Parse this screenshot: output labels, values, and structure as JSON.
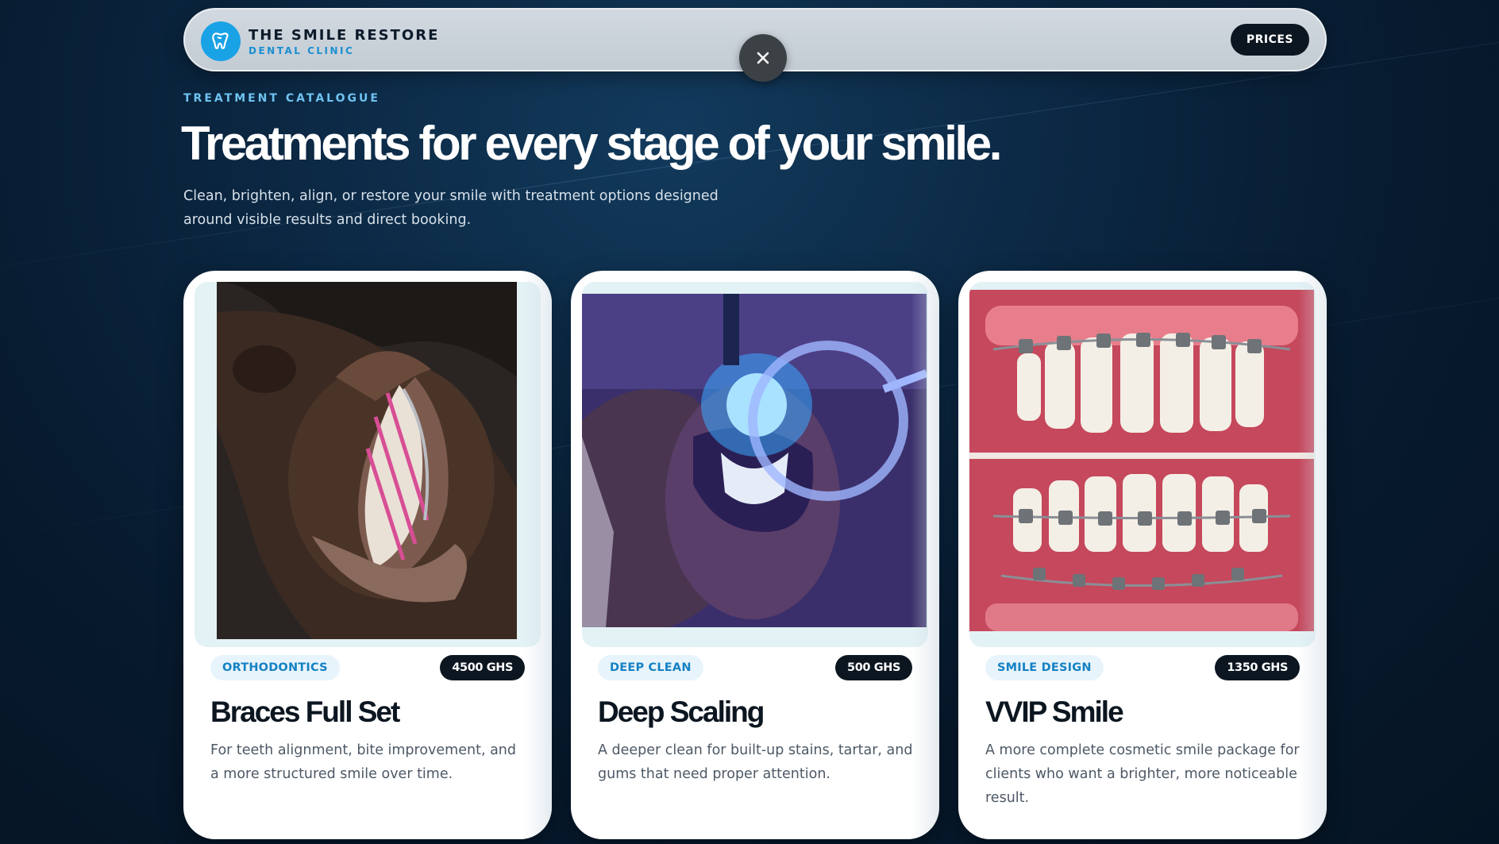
{
  "header": {
    "brand_name": "THE SMILE RESTORE",
    "brand_sub": "DENTAL CLINIC",
    "logo_icon": "tooth-icon",
    "prices_label": "PRICES",
    "close_icon": "close-icon"
  },
  "hero": {
    "eyebrow": "TREATMENT CATALOGUE",
    "title": "Treatments for every stage of your smile.",
    "subtitle": "Clean, brighten, align, or restore your smile with treatment options designed around visible results and direct booking."
  },
  "cards": [
    {
      "category": "ORTHODONTICS",
      "price": "4500 GHS",
      "title": "Braces Full Set",
      "description": "For teeth alignment, bite improvement, and a more structured smile over time."
    },
    {
      "category": "DEEP CLEAN",
      "price": "500 GHS",
      "title": "Deep Scaling",
      "description": "A deeper clean for built-up stains, tartar, and gums that need proper attention."
    },
    {
      "category": "SMILE DESIGN",
      "price": "1350 GHS",
      "title": "VVIP Smile",
      "description": "A more complete cosmetic smile package for clients who want a brighter, more noticeable result."
    }
  ],
  "colors": {
    "accent": "#1aa2e6",
    "dark": "#0c1620",
    "background": "#0b2742"
  }
}
